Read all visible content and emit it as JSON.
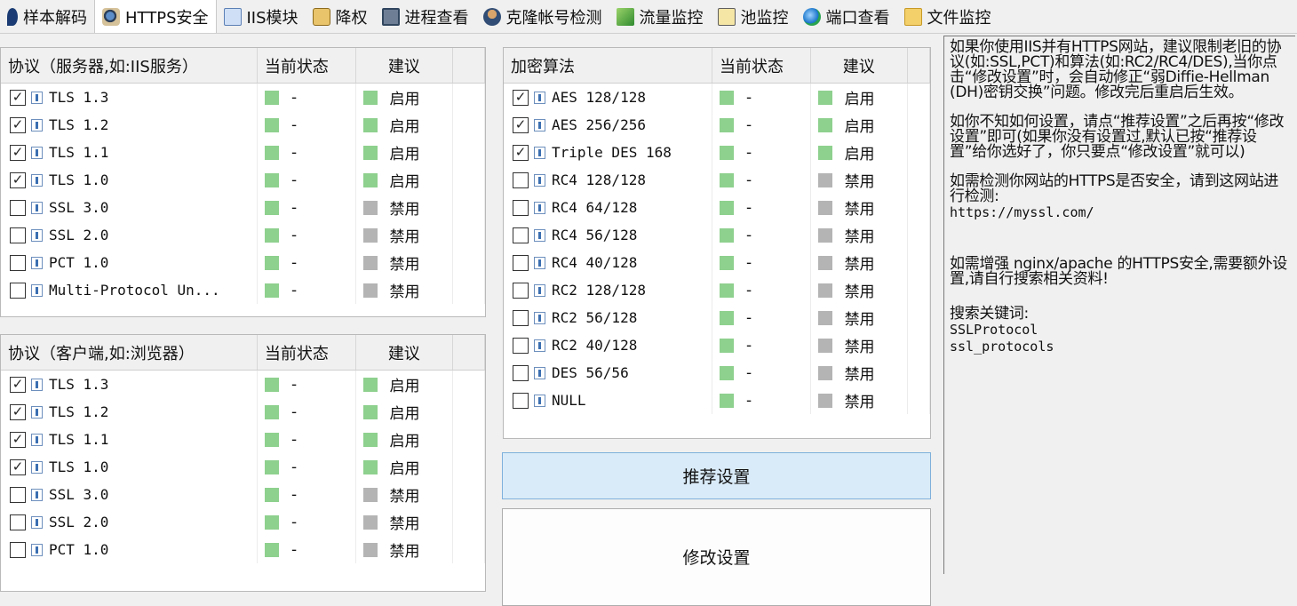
{
  "tabs": [
    {
      "label": "样本解码",
      "icon": "bird-icon",
      "active": false
    },
    {
      "label": "HTTPS安全",
      "icon": "magnifier-person-icon",
      "active": true
    },
    {
      "label": "IIS模块",
      "icon": "document-icon",
      "active": false
    },
    {
      "label": "降权",
      "icon": "clipboard-icon",
      "active": false
    },
    {
      "label": "进程查看",
      "icon": "window-icon",
      "active": false
    },
    {
      "label": "克隆帐号检测",
      "icon": "user-icon",
      "active": false
    },
    {
      "label": "流量监控",
      "icon": "chart-icon",
      "active": false
    },
    {
      "label": "池监控",
      "icon": "notepad-icon",
      "active": false
    },
    {
      "label": "端口查看",
      "icon": "globe-icon",
      "active": false
    },
    {
      "label": "文件监控",
      "icon": "folder-icon",
      "active": false
    }
  ],
  "server_table": {
    "headers": [
      "协议（服务器,如:IIS服务）",
      "当前状态",
      "建议"
    ],
    "rows": [
      {
        "checked": true,
        "name": "TLS 1.3",
        "status": "-",
        "status_color": "green",
        "advice": "启用",
        "advice_color": "green"
      },
      {
        "checked": true,
        "name": "TLS 1.2",
        "status": "-",
        "status_color": "green",
        "advice": "启用",
        "advice_color": "green"
      },
      {
        "checked": true,
        "name": "TLS 1.1",
        "status": "-",
        "status_color": "green",
        "advice": "启用",
        "advice_color": "green"
      },
      {
        "checked": true,
        "name": "TLS 1.0",
        "status": "-",
        "status_color": "green",
        "advice": "启用",
        "advice_color": "green"
      },
      {
        "checked": false,
        "name": "SSL 3.0",
        "status": "-",
        "status_color": "green",
        "advice": "禁用",
        "advice_color": "grey"
      },
      {
        "checked": false,
        "name": "SSL 2.0",
        "status": "-",
        "status_color": "green",
        "advice": "禁用",
        "advice_color": "grey"
      },
      {
        "checked": false,
        "name": "PCT 1.0",
        "status": "-",
        "status_color": "green",
        "advice": "禁用",
        "advice_color": "grey"
      },
      {
        "checked": false,
        "name": "Multi-Protocol Un...",
        "status": "-",
        "status_color": "green",
        "advice": "禁用",
        "advice_color": "grey"
      }
    ]
  },
  "client_table": {
    "headers": [
      "协议（客户端,如:浏览器）",
      "当前状态",
      "建议"
    ],
    "rows": [
      {
        "checked": true,
        "name": "TLS 1.3",
        "status": "-",
        "status_color": "green",
        "advice": "启用",
        "advice_color": "green"
      },
      {
        "checked": true,
        "name": "TLS 1.2",
        "status": "-",
        "status_color": "green",
        "advice": "启用",
        "advice_color": "green"
      },
      {
        "checked": true,
        "name": "TLS 1.1",
        "status": "-",
        "status_color": "green",
        "advice": "启用",
        "advice_color": "green"
      },
      {
        "checked": true,
        "name": "TLS 1.0",
        "status": "-",
        "status_color": "green",
        "advice": "启用",
        "advice_color": "green"
      },
      {
        "checked": false,
        "name": "SSL 3.0",
        "status": "-",
        "status_color": "green",
        "advice": "禁用",
        "advice_color": "grey"
      },
      {
        "checked": false,
        "name": "SSL 2.0",
        "status": "-",
        "status_color": "green",
        "advice": "禁用",
        "advice_color": "grey"
      },
      {
        "checked": false,
        "name": "PCT 1.0",
        "status": "-",
        "status_color": "green",
        "advice": "禁用",
        "advice_color": "grey"
      }
    ]
  },
  "cipher_table": {
    "headers": [
      "加密算法",
      "当前状态",
      "建议"
    ],
    "rows": [
      {
        "checked": true,
        "name": "AES 128/128",
        "status": "-",
        "status_color": "green",
        "advice": "启用",
        "advice_color": "green"
      },
      {
        "checked": true,
        "name": "AES 256/256",
        "status": "-",
        "status_color": "green",
        "advice": "启用",
        "advice_color": "green"
      },
      {
        "checked": true,
        "name": "Triple DES 168",
        "status": "-",
        "status_color": "green",
        "advice": "启用",
        "advice_color": "green"
      },
      {
        "checked": false,
        "name": "RC4 128/128",
        "status": "-",
        "status_color": "green",
        "advice": "禁用",
        "advice_color": "grey"
      },
      {
        "checked": false,
        "name": "RC4 64/128",
        "status": "-",
        "status_color": "green",
        "advice": "禁用",
        "advice_color": "grey"
      },
      {
        "checked": false,
        "name": "RC4 56/128",
        "status": "-",
        "status_color": "green",
        "advice": "禁用",
        "advice_color": "grey"
      },
      {
        "checked": false,
        "name": "RC4 40/128",
        "status": "-",
        "status_color": "green",
        "advice": "禁用",
        "advice_color": "grey"
      },
      {
        "checked": false,
        "name": "RC2 128/128",
        "status": "-",
        "status_color": "green",
        "advice": "禁用",
        "advice_color": "grey"
      },
      {
        "checked": false,
        "name": "RC2 56/128",
        "status": "-",
        "status_color": "green",
        "advice": "禁用",
        "advice_color": "grey"
      },
      {
        "checked": false,
        "name": "RC2 40/128",
        "status": "-",
        "status_color": "green",
        "advice": "禁用",
        "advice_color": "grey"
      },
      {
        "checked": false,
        "name": "DES 56/56",
        "status": "-",
        "status_color": "green",
        "advice": "禁用",
        "advice_color": "grey"
      },
      {
        "checked": false,
        "name": "NULL",
        "status": "-",
        "status_color": "green",
        "advice": "禁用",
        "advice_color": "grey"
      }
    ]
  },
  "buttons": {
    "recommend_label": "推荐设置",
    "modify_label": "修改设置"
  },
  "info": {
    "para1": "如果你使用IIS并有HTTPS网站，建议限制老旧的协议(如:SSL,PCT)和算法(如:RC2/RC4/DES),当你点击“修改设置”时，会自动修正“弱Diffie-Hellman (DH)密钥交换”问题。修改完后重启后生效。",
    "para2": "如你不知如何设置，请点“推荐设置”之后再按“修改设置”即可(如果你没有设置过,默认已按“推荐设置”给你选好了，你只要点“修改设置”就可以)",
    "para3": "如需检测你网站的HTTPS是否安全，请到这网站进行检测:",
    "url": "https://myssl.com/",
    "para4": "如需增强 nginx/apache 的HTTPS安全,需要额外设置,请自行搜索相关资料!",
    "keywords_label": "搜索关键词:",
    "keyword1": "SSLProtocol",
    "keyword2": "ssl_protocols"
  },
  "colors": {
    "green": "#8ed08e",
    "grey": "#b4b4b4",
    "button_highlight": "#d9ebf8"
  }
}
